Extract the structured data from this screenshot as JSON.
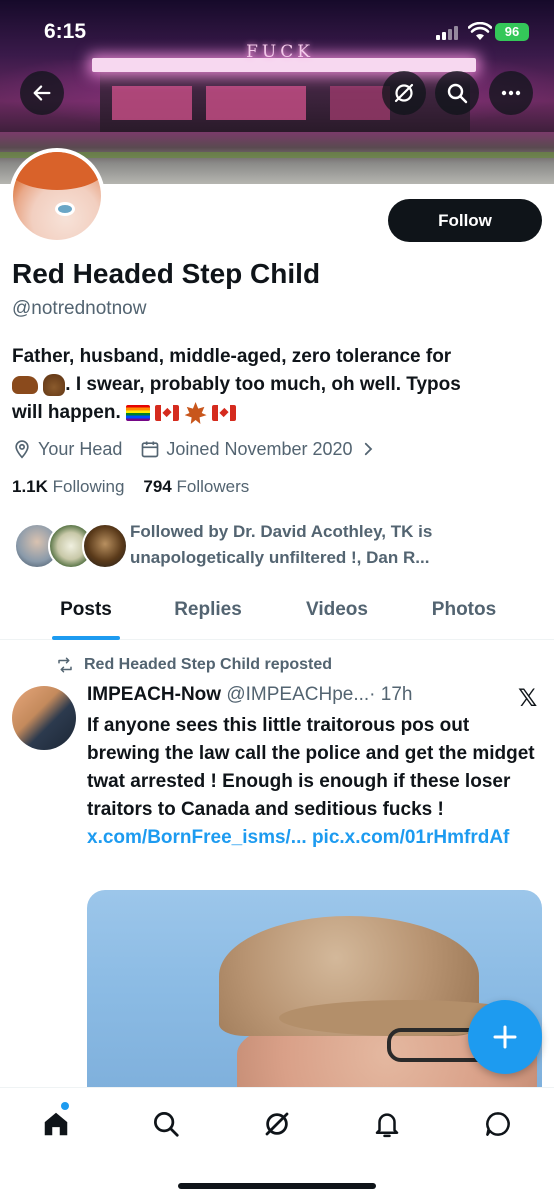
{
  "status_bar": {
    "time": "6:15",
    "battery": "96"
  },
  "banner": {
    "sign_text": "FUCK"
  },
  "profile": {
    "display_name": "Red Headed Step Child",
    "handle": "@notrednotnow",
    "follow_label": "Follow",
    "bio_line_1": "Father, husband, middle-aged, zero tolerance for",
    "bio_line_2": ". I swear, probably too much, oh well. Typos",
    "bio_line_3": "will happen.",
    "location": "Your Head",
    "joined": "Joined November 2020",
    "following_count": "1.1K",
    "following_label": "Following",
    "followers_count": "794",
    "followers_label": "Followers",
    "followed_by": "Followed by Dr. David Acothley, TK is unapologetically unfiltered !, Dan R..."
  },
  "tabs": [
    {
      "label": "Posts",
      "active": true
    },
    {
      "label": "Replies",
      "active": false
    },
    {
      "label": "Videos",
      "active": false
    },
    {
      "label": "Photos",
      "active": false
    }
  ],
  "tweet": {
    "repost_label": "Red Headed Step Child reposted",
    "author_name": "IMPEACH-Now",
    "author_handle": "@IMPEACHpe...",
    "time": "· 17h",
    "text": "If anyone sees this little traitorous pos out brewing the law call the police and get the midget twat arrested ! Enough is enough if these loser traitors to Canada and seditious fucks !",
    "link_1": "x.com/BornFree_isms/...",
    "link_2": "pic.x.com/01rHmfrdAf"
  },
  "icons": {
    "back": "back-arrow-icon",
    "grok": "grok-icon",
    "search": "search-icon",
    "more": "more-icon",
    "location": "location-icon",
    "calendar": "calendar-icon",
    "repost": "repost-icon",
    "x": "x-logo-icon",
    "compose": "plus-icon",
    "home": "home-icon",
    "notifications": "bell-icon",
    "messages": "message-icon"
  },
  "colors": {
    "accent": "#1d9bf0",
    "text": "#0f1419",
    "muted": "#536471",
    "battery": "#34c759"
  }
}
